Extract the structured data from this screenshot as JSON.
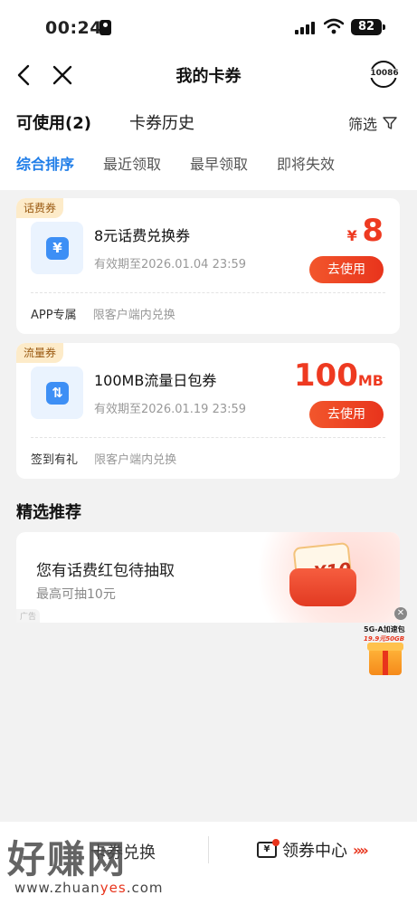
{
  "status_bar": {
    "time": "00:24",
    "battery": "82"
  },
  "nav": {
    "title": "我的卡券",
    "service_label": "10086"
  },
  "tabs": {
    "available": "可使用(2)",
    "history": "卡券历史",
    "filter": "筛选"
  },
  "sort_options": [
    "综合排序",
    "最近领取",
    "最早领取",
    "即将失效"
  ],
  "coupons": [
    {
      "tag": "话费券",
      "icon_glyph": "¥",
      "icon": "yuan-icon",
      "name": "8元话费兑换券",
      "expiry": "有效期至2026.01.04 23:59",
      "currency": "¥",
      "value": "8",
      "unit": "",
      "button": "去使用",
      "scope": "APP专属",
      "note": "限客户端内兑换"
    },
    {
      "tag": "流量券",
      "icon_glyph": "⇅",
      "icon": "data-transfer-icon",
      "name": "100MB流量日包券",
      "expiry": "有效期至2026.01.19 23:59",
      "currency": "",
      "value": "100",
      "unit": "MB",
      "button": "去使用",
      "scope": "签到有礼",
      "note": "限客户端内兑换"
    }
  ],
  "recommend": {
    "section_title": "精选推荐",
    "promo_title": "您有话费红包待抽取",
    "promo_sub": "最高可抽10元",
    "envelope_amount": "¥10",
    "ad_label": "广告"
  },
  "float_ad": {
    "line1": "5G-A加速包",
    "line2": "19.9元50GB"
  },
  "bottom_bar": {
    "left": "卡券兑换",
    "right": "领券中心",
    "arrows": "»»"
  },
  "watermark": {
    "text": "好赚网",
    "url_prefix": "www.zhuan",
    "url_highlight": "yes",
    "url_suffix": ".com"
  },
  "colors": {
    "accent_blue": "#1f7de8",
    "accent_red": "#e8341c",
    "tag_bg": "#fdebc9"
  }
}
